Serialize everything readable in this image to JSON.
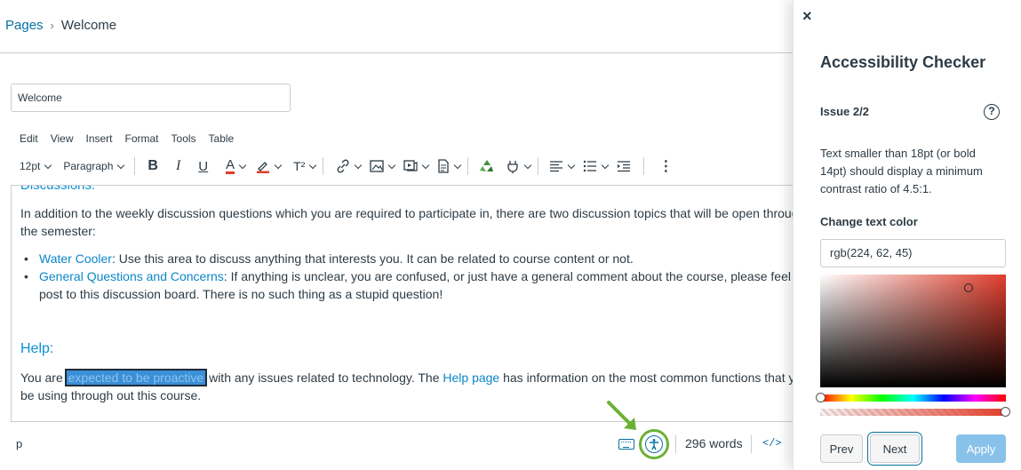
{
  "breadcrumb": {
    "parent": "Pages",
    "separator": "›",
    "current": "Welcome"
  },
  "page_title_input": {
    "value": "Welcome"
  },
  "menubar": [
    "Edit",
    "View",
    "Insert",
    "Format",
    "Tools",
    "Table"
  ],
  "toolbar": {
    "font_size": "12pt",
    "block_format": "Paragraph",
    "bold": "B",
    "italic": "I",
    "underline": "U",
    "text_color": "A",
    "superscript": "T²"
  },
  "content": {
    "heading_top": "Discussions:",
    "para1": "In addition to the weekly discussion questions which you are required to participate in, there are two discussion topics that will be open through out",
    "para1_cont": "the semester:",
    "bullets": [
      {
        "link": "Water Cooler",
        "text": ": Use this area to discuss anything that interests you. It can be related to course content or not."
      },
      {
        "link": "General Questions and Concerns",
        "text": ": If anything is unclear, you are confused, or just have a general comment about the course, please feel free to",
        "cont": "post to this discussion board. There is no such thing as a stupid question!"
      }
    ],
    "help_heading": "Help:",
    "para2_pre": "You are",
    "para2_highlight": "expected to be proactive",
    "para2_mid": "with any issues related to technology. The",
    "para2_link": "Help page",
    "para2_post": "has information on the most common functions that you will",
    "para2_cont": "be using through out this course."
  },
  "statusbar": {
    "path": "p",
    "word_count": "296 words",
    "html_toggle": "</>"
  },
  "panel": {
    "close": "×",
    "title": "Accessibility Checker",
    "issue": "Issue 2/2",
    "help": "?",
    "description": "Text smaller than 18pt (or bold 14pt) should display a minimum contrast ratio of 4.5:1.",
    "color_label": "Change text color",
    "color_value": "rgb(224, 62, 45)",
    "prev": "Prev",
    "next": "Next",
    "apply": "Apply"
  },
  "colors": {
    "accent": "#0770a3",
    "link": "#0b87c8",
    "highlight_ring": "#6bb135",
    "apply_disabled": "#88c2ea"
  }
}
